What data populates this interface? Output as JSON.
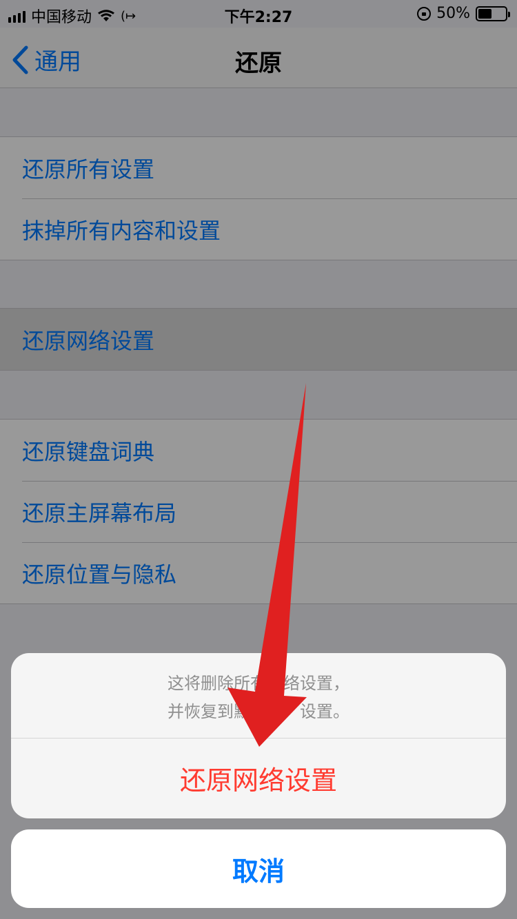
{
  "status_bar": {
    "carrier": "中国移动",
    "time": "下午2:27",
    "battery_percent_text": "50%",
    "battery_level": 0.5
  },
  "nav": {
    "back_label": "通用",
    "title": "还原"
  },
  "groups": {
    "g1": [
      "还原所有设置",
      "抹掉所有内容和设置"
    ],
    "g2": [
      "还原网络设置"
    ],
    "g3": [
      "还原键盘词典",
      "还原主屏幕布局",
      "还原位置与隐私"
    ]
  },
  "sheet": {
    "message_line1": "这将删除所有网络设置，",
    "message_line2": "并恢复到默认出厂设置。",
    "action_label": "还原网络设置",
    "cancel_label": "取消"
  },
  "colors": {
    "accent": "#007aff",
    "destructive": "#ff3b30",
    "annotation_arrow": "#e02020"
  },
  "icons": [
    "signal-icon",
    "wifi-icon",
    "data-arrow-icon",
    "rotation-lock-icon",
    "battery-icon",
    "chevron-left-icon",
    "arrow-annotation"
  ]
}
